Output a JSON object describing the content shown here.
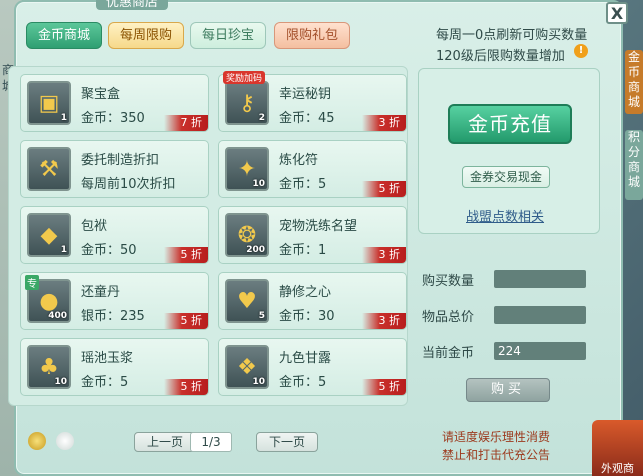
{
  "window": {
    "title": "优惠商店",
    "close_glyph": "X"
  },
  "tabs": [
    {
      "label": "金币商城"
    },
    {
      "label": "每周限购"
    },
    {
      "label": "每日珍宝"
    },
    {
      "label": "限购礼包"
    }
  ],
  "info": {
    "line1": "每周一0点刷新可购买数量",
    "line2": "120级后限购数量增加",
    "warn_icon": "!"
  },
  "items": [
    {
      "name": "聚宝盒",
      "price": "金币：350",
      "count": "1",
      "discount": "7 折",
      "icon": "treasure-box-icon",
      "glyph": "▣"
    },
    {
      "name": "幸运秘钥",
      "price": "金币：45",
      "count": "2",
      "discount": "3 折",
      "icon": "key-icon",
      "glyph": "⚷",
      "tag": "奖励加码"
    },
    {
      "name": "委托制造折扣",
      "price": "每周前10次折扣",
      "count": "",
      "discount": "",
      "icon": "hammer-icon",
      "glyph": "⚒"
    },
    {
      "name": "炼化符",
      "price": "金币：5",
      "count": "10",
      "discount": "5 折",
      "icon": "talisman-icon",
      "glyph": "✦"
    },
    {
      "name": "包袱",
      "price": "金币：50",
      "count": "1",
      "discount": "5 折",
      "icon": "bag-icon",
      "glyph": "◆"
    },
    {
      "name": "宠物洗练名望",
      "price": "金币：1",
      "count": "200",
      "discount": "3 折",
      "icon": "paw-icon",
      "glyph": "❂"
    },
    {
      "name": "还童丹",
      "price": "银币：235",
      "count": "400",
      "discount": "5 折",
      "icon": "pill-icon",
      "glyph": "●",
      "tag2": "专"
    },
    {
      "name": "静修之心",
      "price": "金币：30",
      "count": "5",
      "discount": "3 折",
      "icon": "heart-icon",
      "glyph": "♥"
    },
    {
      "name": "瑶池玉浆",
      "price": "金币：5",
      "count": "10",
      "discount": "5 折",
      "icon": "jade-liquid-icon",
      "glyph": "♣"
    },
    {
      "name": "九色甘露",
      "price": "金币：5",
      "count": "10",
      "discount": "5 折",
      "icon": "dew-icon",
      "glyph": "❖"
    }
  ],
  "right": {
    "recharge": "金币充值",
    "exchange": "金券交易现金",
    "link": "战盟点数相关",
    "buy_qty_label": "购买数量",
    "total_label": "物品总价",
    "current_gold_label": "当前金币",
    "buy_qty_value": "",
    "total_value": "",
    "current_gold_value": "224",
    "buy_btn": "购买"
  },
  "pager": {
    "prev": "上一页",
    "page": "1/3",
    "next": "下一页"
  },
  "notice": {
    "line1": "请适度娱乐理性消费",
    "line2": "禁止和打击代充公告"
  },
  "side": {
    "tab1": "金币商城",
    "tab2": "积分商城",
    "outside": "外观商"
  },
  "left_edge_text": "商城"
}
